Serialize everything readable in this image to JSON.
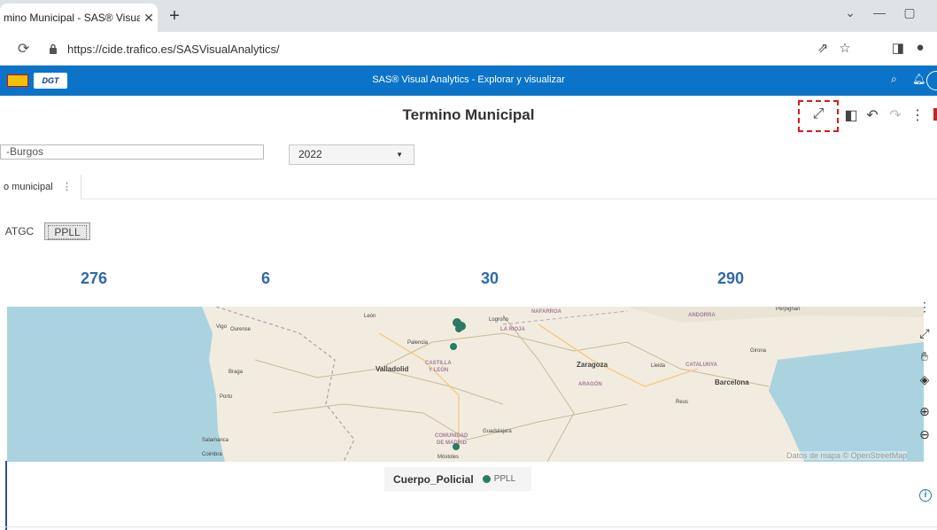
{
  "browser": {
    "tab_title": "mino Municipal - SAS® Visua",
    "tab_close": "✕",
    "new_tab": "+",
    "url": "https://cide.trafico.es/SASVisualAnalytics/"
  },
  "sas": {
    "logo_text": "DGT",
    "app_title": "SAS® Visual Analytics - Explorar y visualizar"
  },
  "report": {
    "title": "Termino Municipal",
    "filter_value": "-Burgos",
    "year_value": "2022",
    "page_tab_label": "o municipal",
    "buttons": [
      {
        "label": "ATGC"
      },
      {
        "label": "PPLL"
      }
    ],
    "kpis": [
      {
        "value": "276"
      },
      {
        "value": "6"
      },
      {
        "value": "30"
      },
      {
        "value": "290"
      }
    ]
  },
  "map": {
    "place_labels": [
      {
        "text": "León"
      },
      {
        "text": "Logroño"
      },
      {
        "text": "NAFARROA"
      },
      {
        "text": "LA RIOJA"
      },
      {
        "text": "ANDORRA"
      },
      {
        "text": "Perpignan"
      },
      {
        "text": "Vigo"
      },
      {
        "text": "Ourense"
      },
      {
        "text": "Palencia"
      },
      {
        "text": "CASTILLA"
      },
      {
        "text": "Y LEÓN"
      },
      {
        "text": "Valladolid"
      },
      {
        "text": "Zaragoza"
      },
      {
        "text": "Lleida"
      },
      {
        "text": "CATALUNYA"
      },
      {
        "text": "Girona"
      },
      {
        "text": "Braga"
      },
      {
        "text": "ARAGÓN"
      },
      {
        "text": "Barcelona"
      },
      {
        "text": "Porto"
      },
      {
        "text": "Reus"
      },
      {
        "text": "Salamanca"
      },
      {
        "text": "Guadalajara"
      },
      {
        "text": "COMUNIDAD"
      },
      {
        "text": "DE MADRID"
      },
      {
        "text": "Coimbra"
      },
      {
        "text": "Móstoles"
      }
    ],
    "attribution": "Datos de mapa © OpenStreetMap",
    "legend_title": "Cuerpo_Policial",
    "legend_item": "PPLL",
    "marker_color": "#2a7a64"
  },
  "colors": {
    "sas_header": "#0b74c9",
    "kpi": "#2f6aa6",
    "focus_box": "#d91a1a",
    "map_water": "#aad3df",
    "map_land": "#f1ecdf"
  }
}
